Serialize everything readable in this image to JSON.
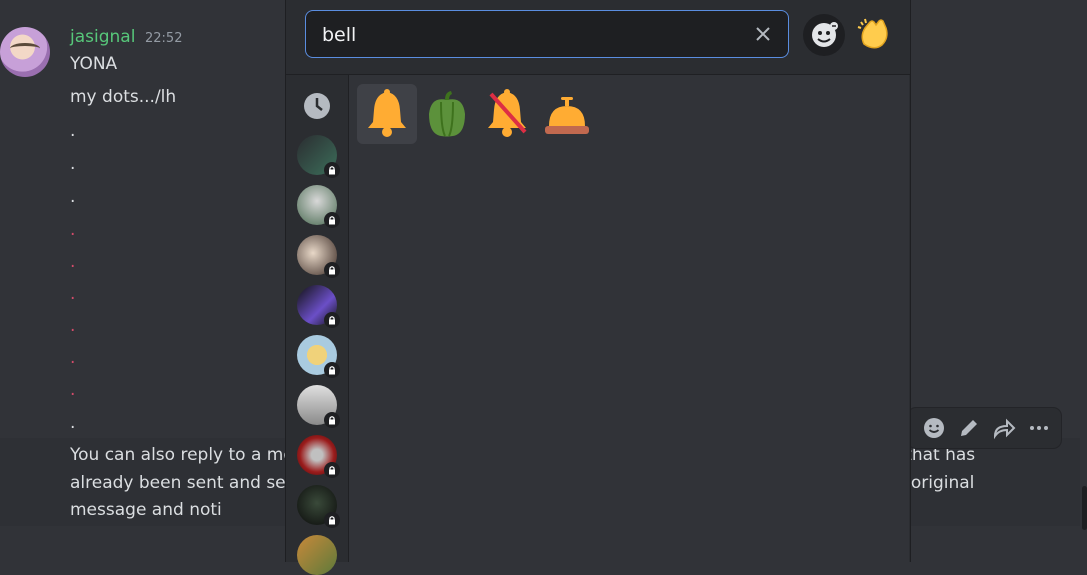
{
  "message": {
    "username": "jasignal",
    "timestamp": "22:52",
    "lines": [
      "YONA",
      "my dots.../lh"
    ],
    "dots": [
      ".",
      ".",
      ".",
      ".",
      ".",
      ".",
      ".",
      ".",
      ".",
      "."
    ],
    "reply_text": "You can also reply to a me                                                                                                       ssage that has already been sent and sele                                                                                                 uotes the original message and noti"
  },
  "colors": {
    "username": "#57c77a",
    "accent_border": "#5a8de0",
    "dot_red": "#d34b6a"
  },
  "emoji_picker": {
    "search_value": "bell",
    "icons": {
      "clear": "close-icon",
      "diversity": "skin-tone-face-icon",
      "clap": "clapping-hands-emoji"
    },
    "categories": [
      {
        "name": "recent-icon"
      },
      {
        "name": "server-icon-1",
        "locked": true
      },
      {
        "name": "server-icon-2",
        "locked": true
      },
      {
        "name": "server-icon-3",
        "locked": true
      },
      {
        "name": "server-icon-4",
        "locked": true
      },
      {
        "name": "server-icon-5",
        "locked": true
      },
      {
        "name": "server-icon-6",
        "locked": true
      },
      {
        "name": "server-icon-7",
        "locked": true
      },
      {
        "name": "server-icon-8",
        "locked": true
      },
      {
        "name": "server-icon-9",
        "locked": true
      }
    ],
    "results": [
      {
        "name": "bell-emoji",
        "active": true
      },
      {
        "name": "bell-pepper-emoji"
      },
      {
        "name": "no-bell-emoji"
      },
      {
        "name": "service-bell-emoji"
      }
    ]
  },
  "message_actions": [
    "add-reaction-icon",
    "edit-icon",
    "forward-icon",
    "more-icon"
  ]
}
